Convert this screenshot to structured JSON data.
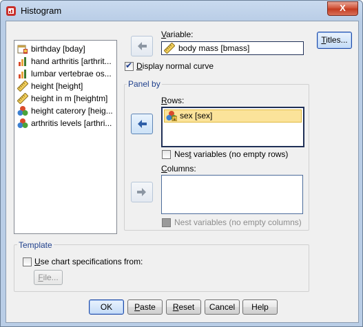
{
  "window": {
    "title": "Histogram",
    "close": "X"
  },
  "variables_list": [
    {
      "label": "birthday [bday]",
      "icon": "date-variable-icon"
    },
    {
      "label": "hand arthritis [arthrit...",
      "icon": "ordinal-variable-icon"
    },
    {
      "label": "lumbar vertebrae os...",
      "icon": "ordinal-variable-icon"
    },
    {
      "label": "height [height]",
      "icon": "scale-variable-icon"
    },
    {
      "label": "height in m [heightm]",
      "icon": "scale-variable-icon"
    },
    {
      "label": "height caterory [heig...",
      "icon": "nominal-variable-icon"
    },
    {
      "label": "arthritis levels [arthri...",
      "icon": "nominal-variable-icon"
    }
  ],
  "variable": {
    "label_prefix": "V",
    "label_rest": "ariable:",
    "value": "body mass [bmass]"
  },
  "display_normal_curve": {
    "label_prefix": "D",
    "label_rest": "isplay normal curve",
    "checked": true
  },
  "panel_by": {
    "title": "Panel by",
    "rows": {
      "label_prefix": "R",
      "label_rest": "ows:",
      "items": [
        "sex [sex]"
      ]
    },
    "nest_rows": {
      "label_prefix": "Nes",
      "label_mid": "t",
      "label_rest": " variables (no empty rows)",
      "checked": false
    },
    "columns": {
      "label_prefix": "C",
      "label_rest": "olumns:"
    },
    "nest_columns": {
      "label": "Nest variables (no empty columns)",
      "checked": false,
      "enabled": false
    }
  },
  "template": {
    "title": "Template",
    "use_spec": {
      "label_prefix": "U",
      "label_rest": "se chart specifications from:",
      "checked": false
    },
    "file_button": {
      "prefix": "F",
      "rest": "ile..."
    }
  },
  "buttons": {
    "titles": {
      "prefix": "T",
      "rest": "itles..."
    },
    "ok": "OK",
    "paste": {
      "prefix": "P",
      "rest": "aste"
    },
    "reset": {
      "prefix": "R",
      "rest": "eset"
    },
    "cancel": "Cancel",
    "help": "Help"
  }
}
